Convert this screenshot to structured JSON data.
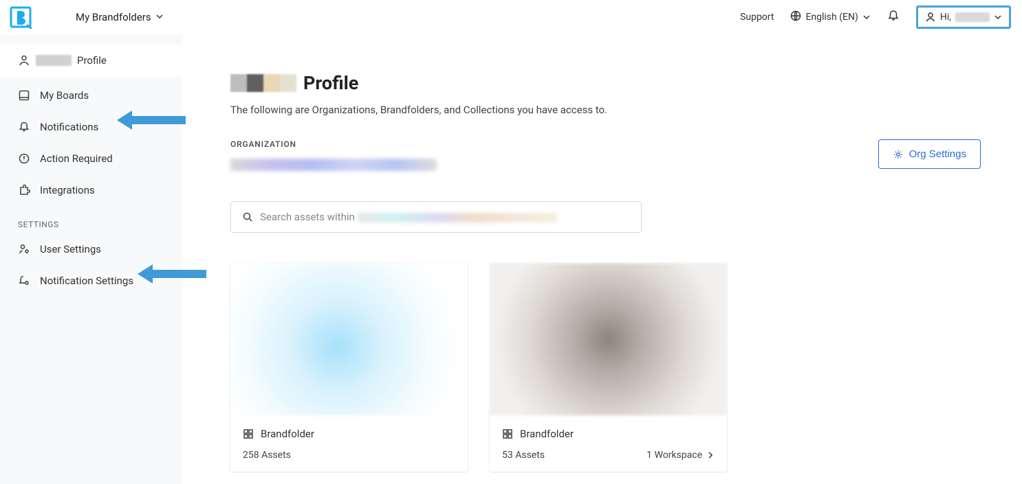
{
  "topbar": {
    "brand_nav": "My Brandfolders",
    "support": "Support",
    "language": "English (EN)",
    "greeting_prefix": "Hi,"
  },
  "sidebar": {
    "profile_suffix": "Profile",
    "items": [
      {
        "label": "My Boards"
      },
      {
        "label": "Notifications"
      },
      {
        "label": "Action Required"
      },
      {
        "label": "Integrations"
      }
    ],
    "settings_header": "SETTINGS",
    "settings_items": [
      {
        "label": "User Settings"
      },
      {
        "label": "Notification Settings"
      }
    ]
  },
  "main": {
    "title_suffix": "Profile",
    "subtitle": "The following are Organizations, Brandfolders, and Collections you have access to.",
    "org_label": "ORGANIZATION",
    "org_settings_btn": "Org Settings",
    "search_prefix": "Search assets within",
    "cards": [
      {
        "type": "Brandfolder",
        "assets": "258 Assets",
        "workspaces": ""
      },
      {
        "type": "Brandfolder",
        "assets": "53 Assets",
        "workspaces": "1 Workspace"
      }
    ]
  }
}
